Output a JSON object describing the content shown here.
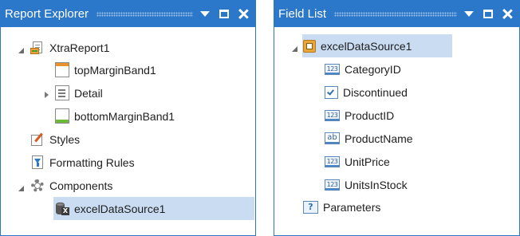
{
  "report_explorer": {
    "title": "Report Explorer",
    "items": [
      {
        "label": "XtraReport1",
        "icon": "report-icon",
        "expander": "expanded"
      },
      {
        "label": "topMarginBand1",
        "icon": "top-margin-band-icon"
      },
      {
        "label": "Detail",
        "icon": "detail-band-icon",
        "expander": "collapsed"
      },
      {
        "label": "bottomMarginBand1",
        "icon": "bottom-margin-band-icon"
      },
      {
        "label": "Styles",
        "icon": "styles-icon"
      },
      {
        "label": "Formatting Rules",
        "icon": "formatting-rules-icon"
      },
      {
        "label": "Components",
        "icon": "components-icon",
        "expander": "expanded"
      },
      {
        "label": "excelDataSource1",
        "icon": "excel-datasource-icon",
        "selected": true
      }
    ]
  },
  "field_list": {
    "title": "Field List",
    "items": [
      {
        "label": "excelDataSource1",
        "icon": "datasource-icon",
        "expander": "expanded",
        "selected": true
      },
      {
        "label": "CategoryID",
        "icon": "numeric-field-icon",
        "icon_text": "123"
      },
      {
        "label": "Discontinued",
        "icon": "boolean-field-icon"
      },
      {
        "label": "ProductID",
        "icon": "numeric-field-icon",
        "icon_text": "123"
      },
      {
        "label": "ProductName",
        "icon": "string-field-icon",
        "icon_text": "ab"
      },
      {
        "label": "UnitPrice",
        "icon": "numeric-field-icon",
        "icon_text": "123"
      },
      {
        "label": "UnitsInStock",
        "icon": "numeric-field-icon",
        "icon_text": "123"
      },
      {
        "label": "Parameters",
        "icon": "parameters-icon",
        "icon_text": "?"
      }
    ]
  },
  "colors": {
    "title_bar": "#2b77c9",
    "selection": "#c9dcf2"
  }
}
